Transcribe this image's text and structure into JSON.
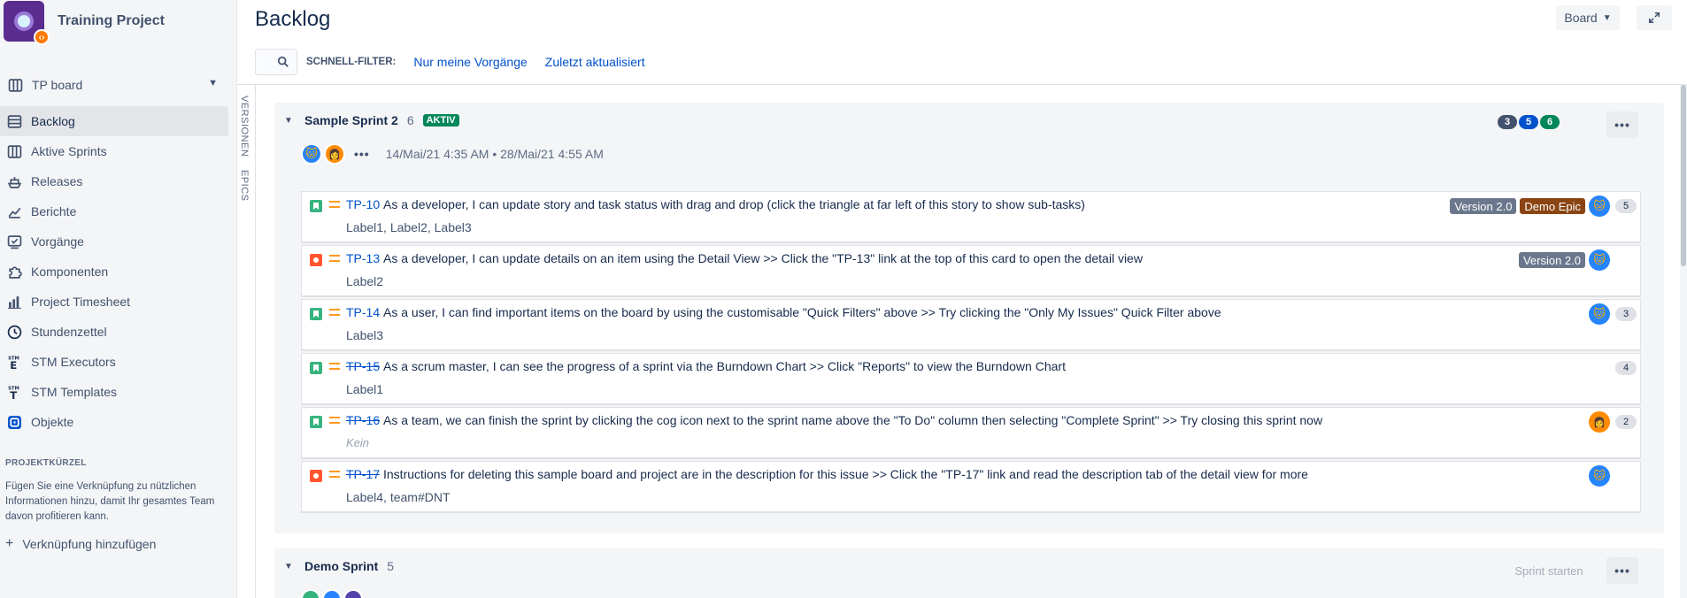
{
  "project": {
    "name": "Training Project"
  },
  "sidebar": {
    "board_selector": "TP board",
    "items": [
      {
        "label": "Backlog",
        "icon": "backlog-icon",
        "active": true
      },
      {
        "label": "Aktive Sprints",
        "icon": "board-icon"
      },
      {
        "label": "Releases",
        "icon": "ship-icon"
      },
      {
        "label": "Berichte",
        "icon": "chart-line-icon"
      },
      {
        "label": "Vorgänge",
        "icon": "issues-icon"
      },
      {
        "label": "Komponenten",
        "icon": "puzzle-icon"
      },
      {
        "label": "Project Timesheet",
        "icon": "bar-chart-icon"
      },
      {
        "label": "Stundenzettel",
        "icon": "clock-icon"
      },
      {
        "label": "STM Executors",
        "icon": "stm-e-icon"
      },
      {
        "label": "STM Templates",
        "icon": "stm-t-icon"
      },
      {
        "label": "Objekte",
        "icon": "objects-icon"
      }
    ],
    "shortcut_heading": "PROJEKTKÜRZEL",
    "shortcut_text": "Fügen Sie eine Verknüpfung zu nützlichen Informationen hinzu, damit Ihr gesamtes Team davon profitieren kann.",
    "add_shortcut": "Verknüpfung hinzufügen"
  },
  "header": {
    "title": "Backlog",
    "board_button": "Board",
    "quick_filter_label": "SCHNELL-FILTER:",
    "filters": [
      "Nur meine Vorgänge",
      "Zuletzt aktualisiert"
    ]
  },
  "side_tabs": {
    "versions": "VERSIONEN",
    "epics": "EPICS"
  },
  "sprint": {
    "name": "Sample Sprint 2",
    "count": "6",
    "status": "AKTIV",
    "dates": "14/Mai/21 4:35 AM  •  28/Mai/21 4:55 AM",
    "status_counts": [
      {
        "value": "3",
        "color": "#42526e"
      },
      {
        "value": "5",
        "color": "#0052cc"
      },
      {
        "value": "6",
        "color": "#00875a"
      }
    ],
    "issues": [
      {
        "type": "story",
        "key": "TP-10",
        "done": false,
        "summary": "As a developer, I can update story and task status with drag and drop (click the triangle at far left of this story to show sub-tasks)",
        "labels": "Label1, Label2, Label3",
        "version": "Version 2.0",
        "epic": "Demo Epic",
        "assignee": "cat",
        "points": "5"
      },
      {
        "type": "bug",
        "key": "TP-13",
        "done": false,
        "summary": "As a developer, I can update details on an item using the Detail View >> Click the \"TP-13\" link at the top of this card to open the detail view",
        "labels": "Label2",
        "version": "Version 2.0",
        "epic": "",
        "assignee": "cat",
        "points": ""
      },
      {
        "type": "story",
        "key": "TP-14",
        "done": false,
        "summary": "As a user, I can find important items on the board by using the customisable \"Quick Filters\" above >> Try clicking the \"Only My Issues\" Quick Filter above",
        "labels": "Label3",
        "version": "",
        "epic": "",
        "assignee": "cat",
        "points": "3"
      },
      {
        "type": "story",
        "key": "TP-15",
        "done": true,
        "summary": "As a scrum master, I can see the progress of a sprint via the Burndown Chart >> Click \"Reports\" to view the Burndown Chart",
        "labels": "Label1",
        "version": "",
        "epic": "",
        "assignee": "",
        "points": "4"
      },
      {
        "type": "story",
        "key": "TP-16",
        "done": true,
        "summary": "As a team, we can finish the sprint by clicking the cog icon next to the sprint name above the \"To Do\" column then selecting \"Complete Sprint\" >> Try closing this sprint now",
        "labels": "Kein",
        "version": "",
        "epic": "",
        "assignee": "girl",
        "points": "2"
      },
      {
        "type": "bug",
        "key": "TP-17",
        "done": true,
        "summary": "Instructions for deleting this sample board and project are in the description for this issue >> Click the \"TP-17\" link and read the description tab of the detail view for more",
        "labels": "Label4, team#DNT",
        "version": "",
        "epic": "",
        "assignee": "cat",
        "points": ""
      }
    ]
  },
  "demo_sprint": {
    "name": "Demo Sprint",
    "count": "5",
    "start_button": "Sprint starten"
  }
}
